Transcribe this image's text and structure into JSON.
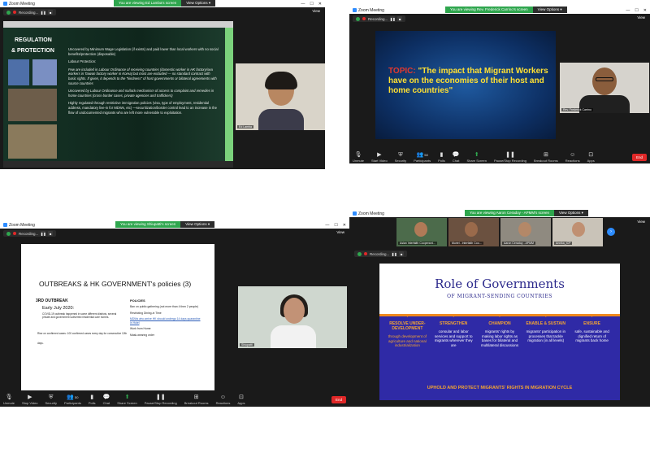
{
  "q1": {
    "title": "Zoom Meeting",
    "share_text": "You are viewing Ed Lamba's screen",
    "view_options": "View Options ▾",
    "recording": "Recording...",
    "view": "View",
    "slide": {
      "heading_a": "REGULATION",
      "heading_b": "&",
      "heading_c": "& PROTECTION",
      "b1": "Uncovered by Minimum Wage Legislation (if exists) and paid lower than local workers with no social benefits/protection (disposable)",
      "b2": "Labour Protection:",
      "b3": "Few are included in Labour Ordinance of receiving countries (domestic worker in HK factory/sea workers in Taiwan factory worker in Korea) but most are excluded — no standard contract with basic rights. If given, it depends to the \"kindness\" of host governments or bilateral agreements with source countries",
      "b4": "Uncovered by Labour Ordinance and no/lack mechanism of access to complaint and remedies in home countries (cross-border cases, private agencies and traffickers)",
      "b5": "Highly regulated through restrictive immigration policies (visa, type of employment, residential address, mandatory live-in for MDWs, etc) —securitization/border control lead to an increase in the flow of undocumented migrants who are left more vulnerable to exploitation."
    },
    "participant_name": "Ed Lamba"
  },
  "q2": {
    "title": "Zoom Meeting",
    "share_text": "You are viewing Rev. Frederick Carrino's screen",
    "view_options": "View Options ▾",
    "recording": "Recording...",
    "view": "View",
    "slide": {
      "topic_label": "TOPIC:",
      "topic_text": "\"The impact that Migrant Workers have on the economies of their host and home countries\""
    },
    "participant_name": "Rev. Frederick Carrino",
    "toolbar": [
      "Unmute",
      "Start Video",
      "Security",
      "Participants",
      "Polls",
      "Chat",
      "Share Screen",
      "Pause/Stop Recording",
      "Breakout Rooms",
      "Reactions",
      "Apps"
    ],
    "participants_count": "58",
    "end": "End"
  },
  "q3": {
    "title": "Zoom Meeting",
    "share_text": "You are viewing Shiupatti's screen",
    "view_options": "View Options ▾",
    "recording": "Recording...",
    "view": "View",
    "slide": {
      "heading": "OUTBREAKS & HK GOVERNMENT's policies (3)",
      "sub_left": "3RD OUTBREAK",
      "early": "Early July 2020:",
      "early_detail": "COVID-19 outbreak happened in some different districts, several private and government subverted residential care homes.",
      "rise": "Rise on confirmed cases: 100 confirmed cases every day for consecutive 12th days.",
      "policies": "POLICIES",
      "p1": "Ban on public gathering (not more than 4 then 2 people)",
      "p2": "Restricting Dining-in Time",
      "p3": "MDWs who arrive HK should undergo 14 days quarantine in Hotel",
      "p4": "Work from Home",
      "p5": "Mask-wearing order"
    },
    "participant_name": "Shiupatti",
    "toolbar": [
      "Unmute",
      "Stop Video",
      "Security",
      "Participants",
      "Polls",
      "Chat",
      "Share Screen",
      "Pause/Stop Recording",
      "Breakout Rooms",
      "Reactions",
      "Apps"
    ],
    "participants_count": "50",
    "end": "End"
  },
  "q4": {
    "title": "Zoom Meeting",
    "share_text": "You are viewing Aaron Ceradoy - APMM's screen",
    "view_options": "View Options ▾",
    "recording": "Recording...",
    "view": "View",
    "participants": [
      "Asian Interfaith Cooperant...",
      "Muriel - Interfaith Coo...",
      "Aaron Ceradoy - APMM",
      "Annika_ICP"
    ],
    "slide": {
      "title": "Role of Governments",
      "subtitle": "OF MIGRANT-SENDING COUNTRIES",
      "columns": [
        {
          "head": "RESOLVE UNDER-DEVELOPMENT",
          "body": "through development of agriculture and national industrialization"
        },
        {
          "head": "STRENGTHEN",
          "body": "consular and labor services and support to migrants wherever they are"
        },
        {
          "head": "CHAMPION",
          "body": "migrants' rights by making labor rights as bases for bilateral and multilateral discussions"
        },
        {
          "head": "ENABLE & SUSTAIN",
          "body": "migrants' participation in processes that tackle migration (in all levels)"
        },
        {
          "head": "ENSURE",
          "body": "safe, sustainable and dignified return of migrants back home"
        }
      ],
      "footer": "UPHOLD AND PROTECT MIGRANTS' RIGHTS IN MIGRATION CYCLE"
    }
  }
}
